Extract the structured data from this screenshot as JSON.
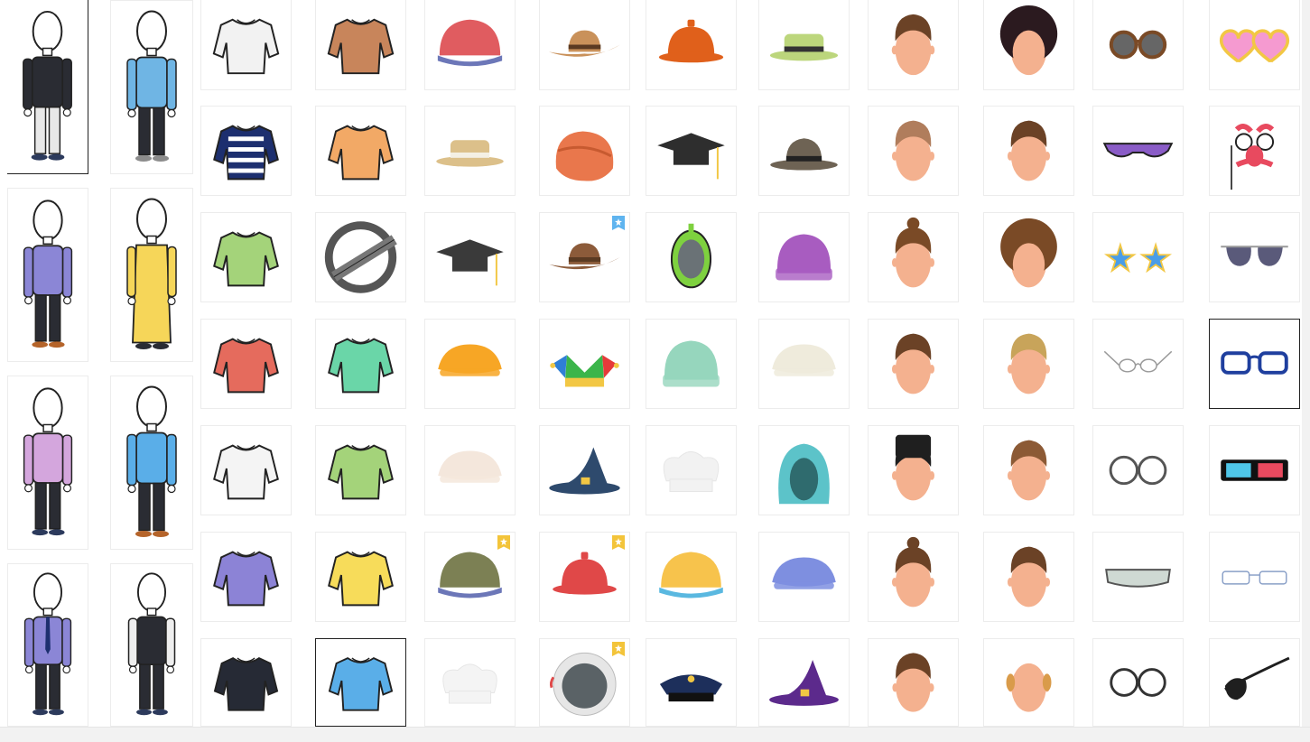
{
  "bodies": [
    {
      "name": "body-black-sweater",
      "icon": "black-sweater-figure-icon",
      "top": "#2a2c33",
      "bottom": "#e8e8e8",
      "shoe": "#2c3a5c"
    },
    {
      "name": "body-blue-plaid",
      "icon": "plaid-shirt-figure-icon",
      "top": "#6fb5e4",
      "bottom": "#2a2c33",
      "shoe": "#8c8c8c"
    },
    {
      "name": "body-purple-hoodie",
      "icon": "hoodie-figure-icon",
      "top": "#8b86d6",
      "bottom": "#2a2c33",
      "shoe": "#b5642a"
    },
    {
      "name": "body-yellow-dress",
      "icon": "dress-figure-icon",
      "top": "#f6d659",
      "bottom": "#f6d659",
      "shoe": "#2a2c33"
    },
    {
      "name": "body-lilac-shirt",
      "icon": "lilac-shirt-figure-icon",
      "top": "#d4a6dd",
      "bottom": "#2a2c33",
      "shoe": "#2c3a5c"
    },
    {
      "name": "body-blue-polo",
      "icon": "polo-figure-icon",
      "top": "#5aaee8",
      "bottom": "#2a2c33",
      "shoe": "#b5642a"
    },
    {
      "name": "body-purple-tie",
      "icon": "tie-figure-icon",
      "top": "#8b86d6",
      "bottom": "#2a2c33",
      "shoe": "#2c3a5c"
    },
    {
      "name": "body-black-vest",
      "icon": "vest-figure-icon",
      "top": "#2a2c33",
      "bottom": "#2a2c33",
      "shoe": "#2c3a5c"
    }
  ],
  "grid": [
    [
      {
        "name": "white-jacket",
        "icon": "jacket-icon",
        "kind": "shirt",
        "color": "#f2f2f2"
      },
      {
        "name": "navy-striped-sweater",
        "icon": "striped-sweater-icon",
        "kind": "shirt",
        "color": "#1d2f6f"
      },
      {
        "name": "green-polo",
        "icon": "polo-icon",
        "kind": "shirt",
        "color": "#a4d37a"
      },
      {
        "name": "red-plaid-shirt",
        "icon": "plaid-shirt-icon",
        "kind": "shirt",
        "color": "#e56b5d"
      },
      {
        "name": "chef-coat",
        "icon": "chef-coat-icon",
        "kind": "shirt",
        "color": "#f4f4f4"
      },
      {
        "name": "purple-sport-shirt",
        "icon": "sport-shirt-icon",
        "kind": "shirt",
        "color": "#8c83d6"
      },
      {
        "name": "black-jacket",
        "icon": "black-jacket-icon",
        "kind": "shirt",
        "color": "#262a35"
      }
    ],
    [
      {
        "name": "brown-shirt",
        "icon": "shirt-icon",
        "kind": "shirt",
        "color": "#c8855b"
      },
      {
        "name": "orange-cardigan",
        "icon": "cardigan-icon",
        "kind": "shirt",
        "color": "#f2a966"
      },
      {
        "name": "no-clothing",
        "icon": "none-icon",
        "kind": "none",
        "color": "#555555"
      },
      {
        "name": "mint-tshirt",
        "icon": "tshirt-icon",
        "kind": "shirt",
        "color": "#6ad6a8"
      },
      {
        "name": "green-sweater",
        "icon": "sweater-icon",
        "kind": "shirt",
        "color": "#a4d37a"
      },
      {
        "name": "yellow-tshirt",
        "icon": "tshirt-icon",
        "kind": "shirt",
        "color": "#f7dc5a"
      },
      {
        "name": "blue-hoodie",
        "icon": "hoodie-icon",
        "kind": "shirt",
        "color": "#5aaee8",
        "selected": true
      }
    ],
    [
      {
        "name": "red-cap",
        "icon": "cap-icon",
        "kind": "cap",
        "color": "#e05c60"
      },
      {
        "name": "straw-boater",
        "icon": "boater-hat-icon",
        "kind": "boater",
        "color": "#dcc08a"
      },
      {
        "name": "graduation-cap",
        "icon": "mortarboard-icon",
        "kind": "mortar",
        "color": "#3a3a3a"
      },
      {
        "name": "orange-beret",
        "icon": "beret-icon",
        "kind": "beret",
        "color": "#f7a625"
      },
      {
        "name": "knit-headband",
        "icon": "knit-headband-icon",
        "kind": "beret",
        "color": "#f4e7dc"
      },
      {
        "name": "camo-cap",
        "icon": "camo-cap-icon",
        "kind": "cap",
        "color": "#7c8054",
        "premium": "gold"
      },
      {
        "name": "white-chef-hat",
        "icon": "chef-hat-icon",
        "kind": "chef",
        "color": "#f4f4f4"
      }
    ],
    [
      {
        "name": "cowboy-hat-tan",
        "icon": "cowboy-hat-icon",
        "kind": "cowboy",
        "color": "#c9915a"
      },
      {
        "name": "orange-turban",
        "icon": "turban-icon",
        "kind": "turban",
        "color": "#e9774c"
      },
      {
        "name": "sheriff-hat",
        "icon": "sheriff-hat-icon",
        "kind": "cowboy",
        "color": "#8c5b3a",
        "premium": "blue"
      },
      {
        "name": "jester-hat",
        "icon": "jester-hat-icon",
        "kind": "jester",
        "color": "#5c2a8c"
      },
      {
        "name": "wizard-hat-blue",
        "icon": "wizard-hat-icon",
        "kind": "wizard",
        "color": "#2e4a6d"
      },
      {
        "name": "red-bowl-hat",
        "icon": "bowl-hat-icon",
        "kind": "bowl",
        "color": "#e04848",
        "premium": "gold"
      },
      {
        "name": "astronaut-helmet",
        "icon": "helmet-icon",
        "kind": "helmet",
        "color": "#e8e8e8",
        "premium": "gold"
      }
    ],
    [
      {
        "name": "orange-bowl-hat",
        "icon": "bowl-hat-icon",
        "kind": "bowl",
        "color": "#e0601b"
      },
      {
        "name": "black-mortarboard",
        "icon": "mortarboard-icon",
        "kind": "mortar",
        "color": "#2e2e2e"
      },
      {
        "name": "snorkel-mask",
        "icon": "diving-mask-icon",
        "kind": "mask",
        "color": "#7ed13f"
      },
      {
        "name": "mint-beanie",
        "icon": "beanie-icon",
        "kind": "beanie",
        "color": "#96d6bd"
      },
      {
        "name": "white-chef-toque",
        "icon": "chef-hat-icon",
        "kind": "chef",
        "color": "#f2f2f2"
      },
      {
        "name": "blue-yellow-cap",
        "icon": "cap-icon",
        "kind": "cap",
        "color": "#f7c34c"
      },
      {
        "name": "police-cap",
        "icon": "police-cap-icon",
        "kind": "police",
        "color": "#1d2f5b"
      }
    ],
    [
      {
        "name": "green-sun-hat",
        "icon": "sun-hat-icon",
        "kind": "boater",
        "color": "#bcd67c"
      },
      {
        "name": "grey-fedora",
        "icon": "fedora-icon",
        "kind": "fedora",
        "color": "#6e6354"
      },
      {
        "name": "purple-beanie",
        "icon": "beanie-icon",
        "kind": "beanie",
        "color": "#a85cc0"
      },
      {
        "name": "cream-shower-cap",
        "icon": "shower-cap-icon",
        "kind": "beret",
        "color": "#efebdc"
      },
      {
        "name": "teal-hood",
        "icon": "hood-icon",
        "kind": "hood",
        "color": "#5cc3c9"
      },
      {
        "name": "blue-flat-cap",
        "icon": "flat-cap-icon",
        "kind": "beret",
        "color": "#7e8fe0"
      },
      {
        "name": "purple-witch-hat",
        "icon": "witch-hat-icon",
        "kind": "wizard",
        "color": "#5c2a8c"
      }
    ],
    [
      {
        "name": "hair-short-brown",
        "icon": "hair-icon",
        "kind": "face",
        "color": "#6b4226"
      },
      {
        "name": "hair-buzz",
        "icon": "hair-icon",
        "kind": "face",
        "color": "#b07d5c"
      },
      {
        "name": "hair-man-bun",
        "icon": "hair-icon",
        "kind": "face",
        "color": "#7a4a26"
      },
      {
        "name": "hair-side-part",
        "icon": "hair-icon",
        "kind": "face",
        "color": "#6b4226"
      },
      {
        "name": "hair-flat-top",
        "icon": "hair-icon",
        "kind": "face",
        "color": "#1f1f1f"
      },
      {
        "name": "hair-top-bun",
        "icon": "hair-icon",
        "kind": "face",
        "color": "#6b4226"
      },
      {
        "name": "hair-classic",
        "icon": "hair-icon",
        "kind": "face",
        "color": "#6b4226"
      }
    ],
    [
      {
        "name": "hair-afro-curly",
        "icon": "hair-icon",
        "kind": "afro",
        "color": "#2b1a1f"
      },
      {
        "name": "hair-spiky",
        "icon": "hair-icon",
        "kind": "face",
        "color": "#6b4226"
      },
      {
        "name": "hair-dreadlocks",
        "icon": "hair-icon",
        "kind": "afro",
        "color": "#7a4a26"
      },
      {
        "name": "hair-blonde-quiff",
        "icon": "hair-icon",
        "kind": "face",
        "color": "#c8a45a"
      },
      {
        "name": "hair-textured",
        "icon": "hair-icon",
        "kind": "face",
        "color": "#8c5a35"
      },
      {
        "name": "hair-swept",
        "icon": "hair-icon",
        "kind": "face",
        "color": "#6b4226"
      },
      {
        "name": "hair-balding",
        "icon": "hair-icon",
        "kind": "bald",
        "color": "#d99b4a"
      }
    ],
    [
      {
        "name": "round-sunglasses",
        "icon": "sunglasses-icon",
        "kind": "round-sun",
        "color": "#7a4a26"
      },
      {
        "name": "purple-sport-shades",
        "icon": "sport-glasses-icon",
        "kind": "shades",
        "color": "#8a5cc7"
      },
      {
        "name": "star-glasses",
        "icon": "star-glasses-icon",
        "kind": "stars",
        "color": "#4a9de8"
      },
      {
        "name": "wire-spectacles",
        "icon": "spectacles-icon",
        "kind": "wire",
        "color": "#9a9a9a"
      },
      {
        "name": "round-glasses",
        "icon": "round-glasses-icon",
        "kind": "round",
        "color": "#555555"
      },
      {
        "name": "safety-goggles",
        "icon": "goggles-icon",
        "kind": "goggles",
        "color": "#cfd9d3"
      },
      {
        "name": "black-round-glasses",
        "icon": "round-glasses-icon",
        "kind": "round",
        "color": "#333333"
      }
    ],
    [
      {
        "name": "heart-glasses",
        "icon": "heart-glasses-icon",
        "kind": "hearts",
        "color": "#f59ad0"
      },
      {
        "name": "disguise-mask",
        "icon": "nose-mask-icon",
        "kind": "disguise",
        "color": "#e84a5f"
      },
      {
        "name": "aviator-sunglasses",
        "icon": "aviator-icon",
        "kind": "aviator",
        "color": "#5a5a7a"
      },
      {
        "name": "blue-frame-glasses",
        "icon": "glasses-icon",
        "kind": "rect",
        "color": "#1f3f9e",
        "selected": true
      },
      {
        "name": "3d-glasses",
        "icon": "3d-glasses-icon",
        "kind": "3d",
        "color": "#111111"
      },
      {
        "name": "rimless-glasses",
        "icon": "rimless-glasses-icon",
        "kind": "rimless",
        "color": "#8aa0c8"
      },
      {
        "name": "eye-patch",
        "icon": "eye-patch-icon",
        "kind": "patch",
        "color": "#1f1f1f"
      }
    ]
  ]
}
